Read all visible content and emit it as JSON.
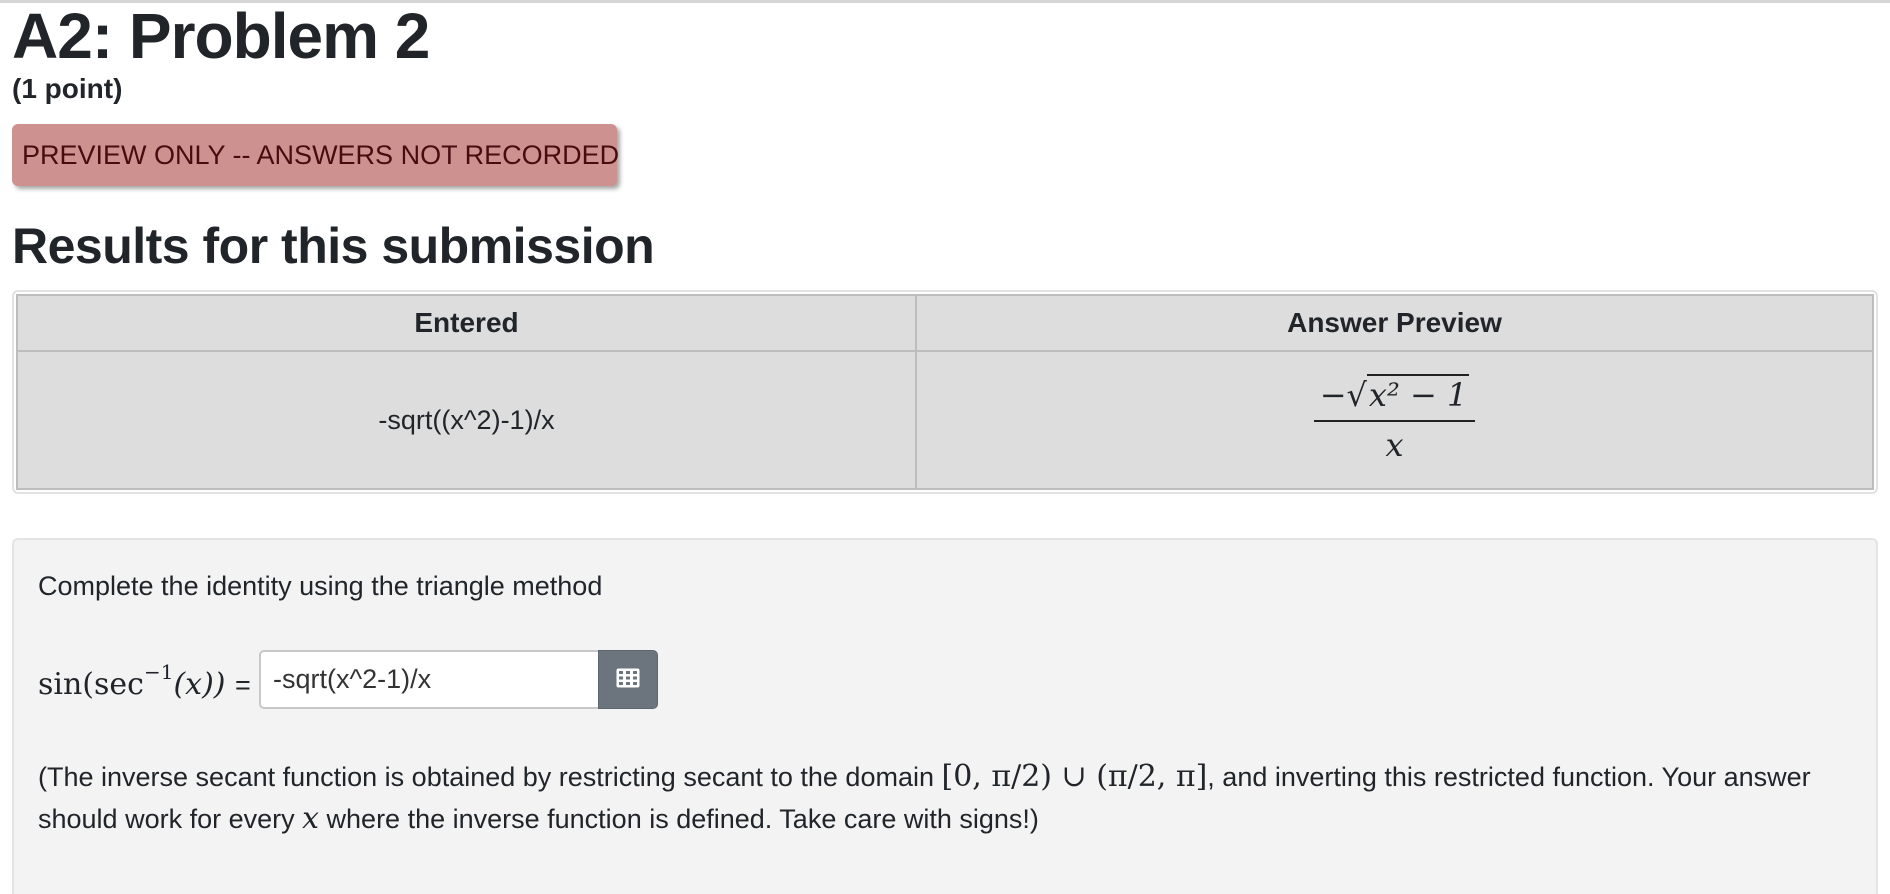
{
  "problem": {
    "title": "A2: Problem 2",
    "points": "(1 point)"
  },
  "banner": {
    "text": "PREVIEW ONLY -- ANSWERS NOT RECORDED",
    "color": "#cd9190"
  },
  "results": {
    "heading": "Results for this submission",
    "columns": [
      "Entered",
      "Answer Preview"
    ],
    "rows": [
      {
        "entered": "-sqrt((x^2)-1)/x",
        "preview_numerator_sign": "−",
        "preview_numerator_radicand": "x² − 1",
        "preview_denominator": "x"
      }
    ]
  },
  "question": {
    "instruction": "Complete the identity using the triangle method",
    "lhs": {
      "func": "sin(sec",
      "exponent": "−1",
      "arg": "(x))",
      "equals": "="
    },
    "answer_value": "-sqrt(x^2-1)/x",
    "equation_button_icon": "grid-icon",
    "note": {
      "part1": "(The inverse secant function is obtained by restricting secant to the domain ",
      "domain": "[0, π/2) ∪ (π/2, π]",
      "part2": ", and inverting this restricted function. Your answer should work for every ",
      "var": "x",
      "part3": " where the inverse function is defined. Take care with signs!)"
    }
  }
}
